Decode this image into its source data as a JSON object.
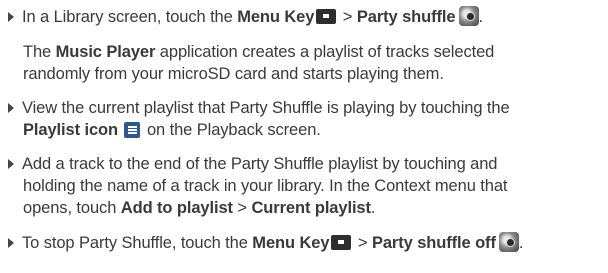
{
  "items": {
    "i1": {
      "l1_pre": "In a Library screen, touch the ",
      "l1_menu": "Menu Key",
      "l1_sep": " > ",
      "l1_action": "Party shuffle"
    },
    "p1": {
      "l1_app": "Music Player",
      "l1_rest": " application creates a playlist of tracks selected",
      "l2": "randomly from your microSD card and starts playing them."
    },
    "i2": {
      "l1": "View the current playlist that Party Shuffle is playing by touching the",
      "l2_icon_label": "Playlist icon",
      "l2_rest": " on the Playback screen."
    },
    "i3": {
      "l1": "Add a track to the end of the Party Shuffle playlist by touching and",
      "l2": "holding the name of a track in your library. In the Context menu that",
      "l3_pre": "opens, touch ",
      "l3_add": "Add to playlist",
      "l3_sep": " > ",
      "l3_current": "Current playlist",
      "l3_end": "."
    },
    "i4": {
      "l1_pre": "To stop Party Shuffle, touch the ",
      "l1_menu": "Menu Key",
      "l1_sep": " > ",
      "l1_action": "Party shuffle off"
    }
  },
  "icons": {
    "menu_key": "menu-key-icon",
    "party_shuffle": "party-shuffle-icon",
    "playlist": "playlist-icon"
  }
}
